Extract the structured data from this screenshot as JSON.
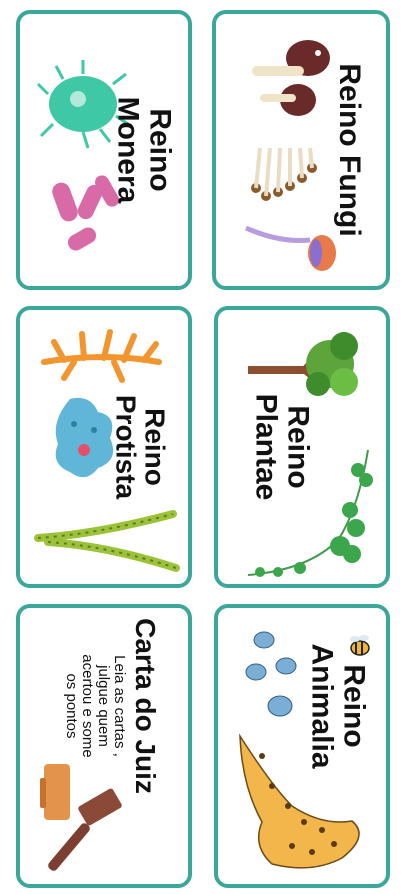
{
  "cards": {
    "fungi": {
      "title": "Reino Fungi"
    },
    "monera": {
      "line1": "Reino",
      "line2": "Monera"
    },
    "plantae": {
      "line1": "Reino",
      "line2": "Plantae"
    },
    "protista": {
      "line1": "Reino",
      "line2": "Protista"
    },
    "animalia": {
      "line1": "Reino",
      "line2": "Animalia"
    },
    "juiz": {
      "title": "Carta do Juiz",
      "instructions": [
        "Leia as cartas ,",
        "julgue quem",
        "acertou e some",
        "os pontos"
      ]
    }
  },
  "colors": {
    "border": "#3aa79a",
    "background": "#ffffff"
  }
}
